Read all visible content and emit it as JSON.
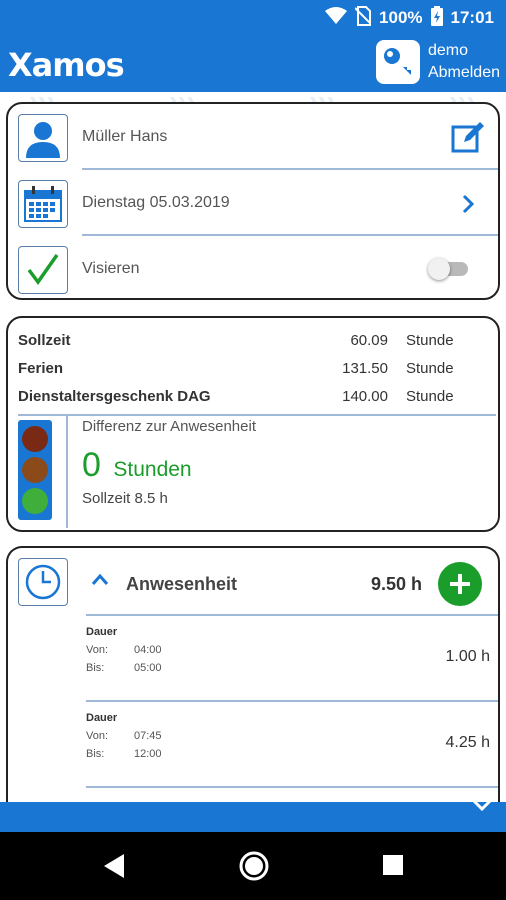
{
  "status_bar": {
    "battery": "100%",
    "time": "17:01"
  },
  "app_bar": {
    "logo": "Xamos",
    "user": "demo",
    "logout": "Abmelden"
  },
  "info_card": {
    "employee": "Müller Hans",
    "date": "Dienstag 05.03.2019",
    "approve_label": "Visieren",
    "approve_on": false
  },
  "balance_card": {
    "rows": [
      {
        "label": "Sollzeit",
        "value": "60.09",
        "unit": "Stunde"
      },
      {
        "label": "Ferien",
        "value": "131.50",
        "unit": "Stunde"
      },
      {
        "label": "Dienstaltersgeschenk DAG",
        "value": "140.00",
        "unit": "Stunde"
      }
    ],
    "difference_label": "Differenz zur Anwesenheit",
    "difference_value": "0",
    "difference_unit": "Stunden",
    "target_time": "Sollzeit 8.5 h",
    "traffic_colors": {
      "red": "#7a2a14",
      "orange": "#8a4a1a",
      "green": "#3fae3a"
    }
  },
  "attendance_card": {
    "title": "Anwesenheit",
    "total": "9.50 h",
    "entries": [
      {
        "type": "Dauer",
        "from_label": "Von:",
        "from": "04:00",
        "to_label": "Bis:",
        "to": "05:00",
        "duration": "1.00 h"
      },
      {
        "type": "Dauer",
        "from_label": "Von:",
        "from": "07:45",
        "to_label": "Bis:",
        "to": "12:00",
        "duration": "4.25 h"
      }
    ]
  },
  "colors": {
    "primary": "#1976d2",
    "accent_green": "#1a9d2a",
    "divider": "#9fb8d6"
  }
}
